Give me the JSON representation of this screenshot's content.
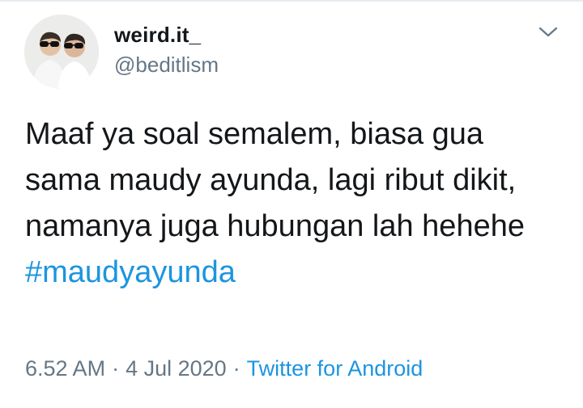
{
  "user": {
    "display_name": "weird.it_",
    "handle": "@beditlism"
  },
  "tweet": {
    "text": "Maaf ya soal semalem, biasa gua sama maudy ayunda, lagi ribut dikit, namanya juga hubungan lah hehehe",
    "hashtag": "#maudyayunda"
  },
  "meta": {
    "time": "6.52 AM",
    "separator": "·",
    "date": "4 Jul 2020",
    "source": "Twitter for Android"
  },
  "icons": {
    "caret": "chevron-down-icon",
    "avatar": "avatar-photo"
  },
  "colors": {
    "text": "#14171a",
    "secondary": "#657786",
    "link": "#1b95e0"
  }
}
